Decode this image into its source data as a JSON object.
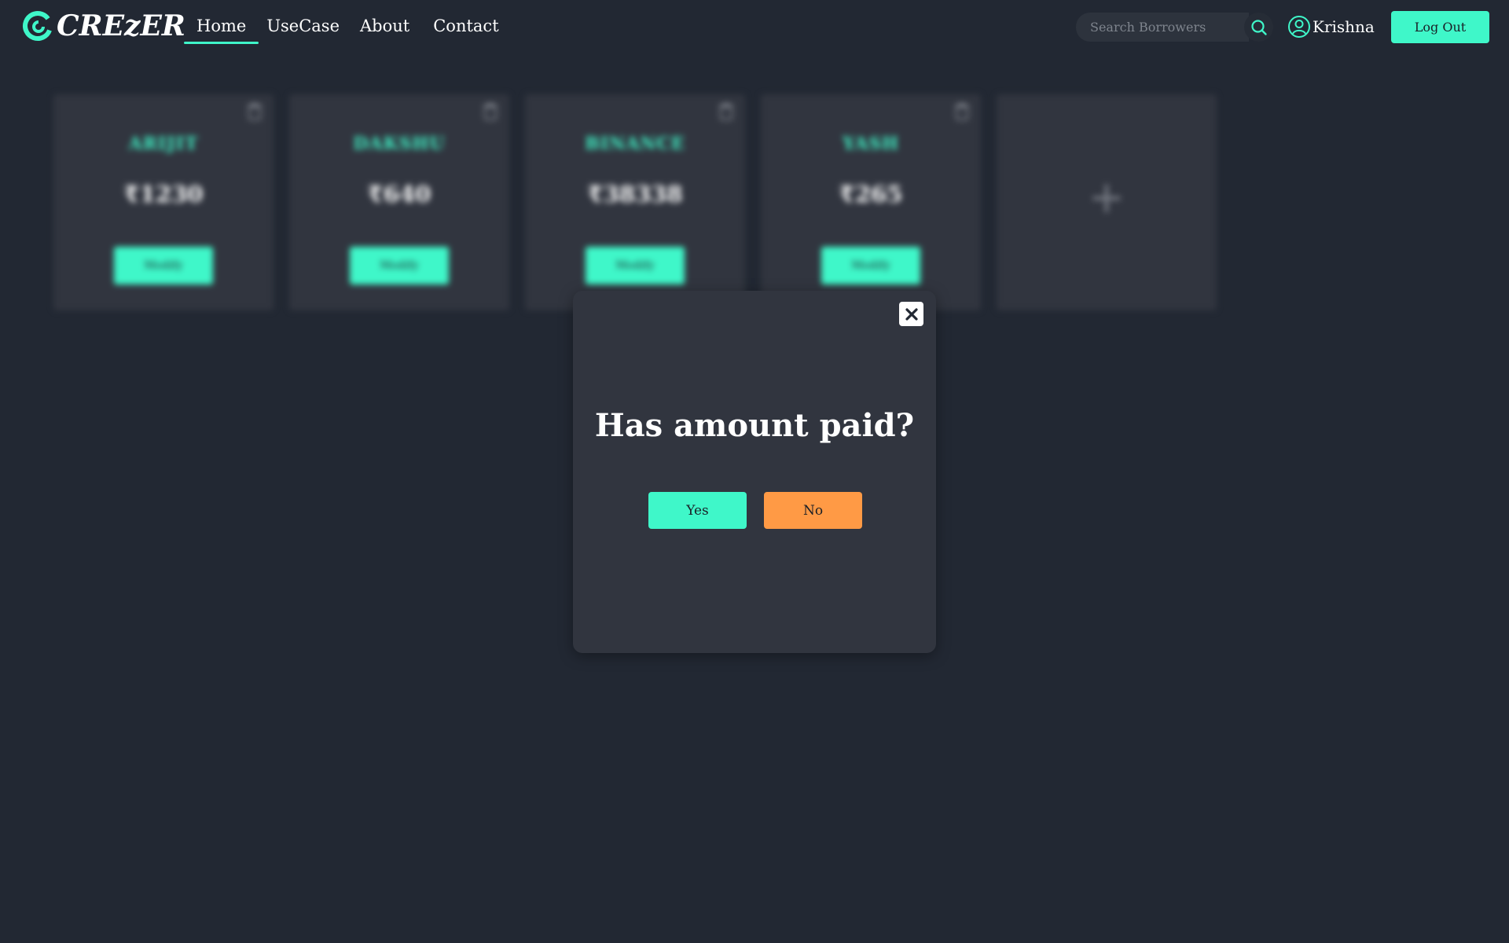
{
  "brand": {
    "name": "CREzER"
  },
  "nav": {
    "items": [
      {
        "label": "Home",
        "active": true
      },
      {
        "label": "UseCase",
        "active": false
      },
      {
        "label": "About",
        "active": false
      },
      {
        "label": "Contact",
        "active": false
      }
    ]
  },
  "search": {
    "placeholder": "Search Borrowers",
    "value": ""
  },
  "user": {
    "name": "Krishna"
  },
  "actions": {
    "logout_label": "Log Out"
  },
  "borrowers": [
    {
      "name": "ARIJIT",
      "amount": "₹1230",
      "button": "Modify"
    },
    {
      "name": "DAKSHU",
      "amount": "₹640",
      "button": "Modify"
    },
    {
      "name": "BINANCE",
      "amount": "₹38338",
      "button": "Modify"
    },
    {
      "name": "YASH",
      "amount": "₹265",
      "button": "Modify"
    }
  ],
  "add_card": {
    "symbol": "+"
  },
  "modal": {
    "title": "Has amount paid?",
    "yes_label": "Yes",
    "no_label": "No",
    "close_symbol": "✕"
  },
  "colors": {
    "background": "#222833",
    "accent": "#3ff7c9",
    "card": "#31353f",
    "no_button": "#ff9a45"
  },
  "icons": [
    "logo-icon",
    "search-icon",
    "user-icon",
    "trash-icon",
    "plus-icon",
    "close-icon"
  ]
}
